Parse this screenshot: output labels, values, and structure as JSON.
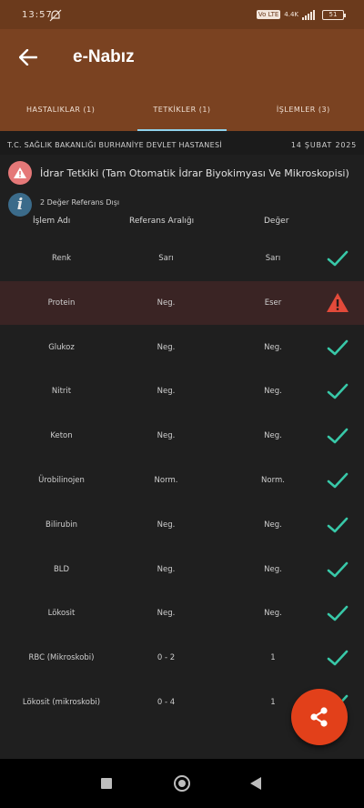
{
  "status": {
    "time": "13:57",
    "net_badge": "Vo LTE",
    "net_speed": "4.4K",
    "battery": "51"
  },
  "header": {
    "title": "e-Nabız",
    "tabs": [
      {
        "label": "HASTALIKLAR (1)"
      },
      {
        "label": "TETKİKLER (1)"
      },
      {
        "label": "İŞLEMLER (3)"
      }
    ]
  },
  "hospital": {
    "name": "T.C. SAĞLIK BAKANLIĞI BURHANİYE DEVLET HASTANESİ",
    "date": "14 ŞUBAT 2025"
  },
  "test": {
    "name": "İdrar Tetkiki (Tam Otomatik İdrar Biyokimyası Ve Mikroskopisi)"
  },
  "info": {
    "text": "2 Değer Referans Dışı"
  },
  "columns": {
    "name": "İşlem Adı",
    "range": "Referans Aralığı",
    "value": "Değer"
  },
  "rows": [
    {
      "name": "Renk",
      "range": "Sarı",
      "value": "Sarı",
      "status": "ok"
    },
    {
      "name": "Protein",
      "range": "Neg.",
      "value": "Eser",
      "status": "warn"
    },
    {
      "name": "Glukoz",
      "range": "Neg.",
      "value": "Neg.",
      "status": "ok"
    },
    {
      "name": "Nitrit",
      "range": "Neg.",
      "value": "Neg.",
      "status": "ok"
    },
    {
      "name": "Keton",
      "range": "Neg.",
      "value": "Neg.",
      "status": "ok"
    },
    {
      "name": "Ürobilinojen",
      "range": "Norm.",
      "value": "Norm.",
      "status": "ok"
    },
    {
      "name": "Bilirubin",
      "range": "Neg.",
      "value": "Neg.",
      "status": "ok"
    },
    {
      "name": "BLD",
      "range": "Neg.",
      "value": "Neg.",
      "status": "ok"
    },
    {
      "name": "Lökosit",
      "range": "Neg.",
      "value": "Neg.",
      "status": "ok"
    },
    {
      "name": "RBC (Mikroskobi)",
      "range": "0 - 2",
      "value": "1",
      "status": "ok"
    },
    {
      "name": "Lökosit (mikroskobi)",
      "range": "0 - 4",
      "value": "1",
      "status": "ok"
    }
  ],
  "colors": {
    "appbar": "#7a4221",
    "ok": "#38c8a8",
    "warn": "#e24a3a",
    "fab": "#e2401a"
  }
}
